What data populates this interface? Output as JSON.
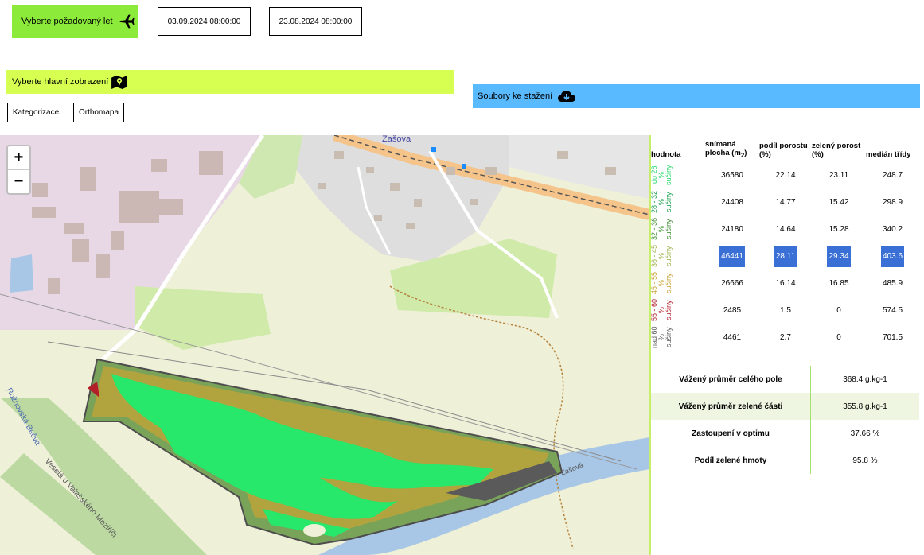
{
  "toolbar": {
    "flight_button": "Vyberte požadovaný let",
    "date_1": "03.09.2024 08:00:00",
    "date_2": "23.08.2024 08:00:00"
  },
  "view_bar": {
    "label": "Vyberte hlavní zobrazení"
  },
  "view_buttons": {
    "categorization": "Kategorizace",
    "orthomap": "Orthomapa"
  },
  "download_bar": {
    "label": "Soubory ke stažení"
  },
  "map": {
    "town_label": "Zašova",
    "river_label_1": "Rožnovská Bečva",
    "river_label_2": "Veselá u Valašského Meziříčí",
    "road_label": "Zašová",
    "zoom_in": "+",
    "zoom_out": "−"
  },
  "table": {
    "headers": {
      "hodnota": "hodnota",
      "area_1": "snímaná",
      "area_2": "plocha (m",
      "area_sub": "2",
      "area_3": ")",
      "cover": "podíl porostu (%)",
      "green": "zelený porost (%)",
      "median": "medián třídy"
    },
    "rows": [
      {
        "label": "do 28 % sušiny",
        "color": "#27d86a",
        "area": "36580",
        "cover": "22.14",
        "green": "23.11",
        "median": "248.7"
      },
      {
        "label": "28 - 32 % sušiny",
        "color": "#1a9e4c",
        "area": "24408",
        "cover": "14.77",
        "green": "15.42",
        "median": "298.9"
      },
      {
        "label": "32 - 36 % sušiny",
        "color": "#3a8c2c",
        "area": "24180",
        "cover": "14.64",
        "green": "15.28",
        "median": "340.2"
      },
      {
        "label": "36 - 45 % sušiny",
        "color": "#9db34a",
        "area": "46441",
        "cover": "28.11",
        "green": "29.34",
        "median": "403.6"
      },
      {
        "label": "45 - 55 % sušiny",
        "color": "#c9a232",
        "area": "26666",
        "cover": "16.14",
        "green": "16.85",
        "median": "485.9"
      },
      {
        "label": "55 - 60 % sušiny",
        "color": "#b3202a",
        "area": "2485",
        "cover": "1.5",
        "green": "0",
        "median": "574.5"
      },
      {
        "label": "nad 60 % sušiny",
        "color": "#5a5a5a",
        "area": "4461",
        "cover": "2.7",
        "green": "0",
        "median": "701.5"
      }
    ]
  },
  "summary": [
    {
      "label": "Vážený průměr celého pole",
      "value": "368.4 g.kg-1"
    },
    {
      "label": "Vážený průměr zelené části",
      "value": "355.8 g.kg-1"
    },
    {
      "label": "Zastoupení v optimu",
      "value": "37.66 %"
    },
    {
      "label": "Podíl zelené hmoty",
      "value": "95.8 %"
    }
  ],
  "colors": {
    "accent_green": "#8ceb3a",
    "accent_yellow": "#d6ff52",
    "accent_blue": "#59baff",
    "highlight": "#3a6fd6"
  }
}
